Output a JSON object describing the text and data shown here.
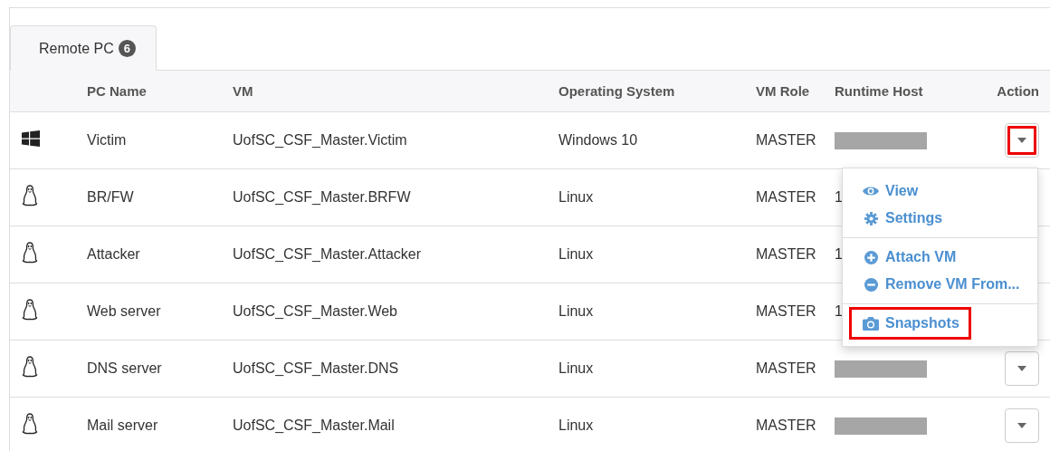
{
  "tabs": [
    {
      "label": "Remote PC",
      "badge": "6",
      "selected": true
    }
  ],
  "table": {
    "columns": [
      "PC Name",
      "VM",
      "Operating System",
      "VM Role",
      "Runtime Host",
      "Action"
    ],
    "rows": [
      {
        "kind": "windows",
        "pc_name": "Victim",
        "vm": "UofSC_CSF_Master.Victim",
        "os": "Windows 10",
        "role": "MASTER",
        "host": {
          "redacted": true
        },
        "action_button": {
          "highlighted": true
        }
      },
      {
        "kind": "linux",
        "pc_name": "BR/FW",
        "vm": "UofSC_CSF_Master.BRFW",
        "os": "Linux",
        "role": "MASTER",
        "host": {
          "text": "1"
        }
      },
      {
        "kind": "linux",
        "pc_name": "Attacker",
        "vm": "UofSC_CSF_Master.Attacker",
        "os": "Linux",
        "role": "MASTER",
        "host": {
          "text": "1"
        }
      },
      {
        "kind": "linux",
        "pc_name": "Web server",
        "vm": "UofSC_CSF_Master.Web",
        "os": "Linux",
        "role": "MASTER",
        "host": {
          "text": "1"
        }
      },
      {
        "kind": "linux",
        "pc_name": "DNS server",
        "vm": "UofSC_CSF_Master.DNS",
        "os": "Linux",
        "role": "MASTER",
        "host": {
          "redacted": true
        },
        "action_button": {
          "highlighted": false
        }
      },
      {
        "kind": "linux",
        "pc_name": "Mail server",
        "vm": "UofSC_CSF_Master.Mail",
        "os": "Linux",
        "role": "MASTER",
        "host": {
          "redacted": true
        },
        "action_button": {
          "highlighted": false
        }
      }
    ]
  },
  "action_menu": {
    "groups": [
      [
        {
          "kind": "view",
          "label": "View",
          "highlighted": false
        },
        {
          "kind": "settings",
          "label": "Settings",
          "highlighted": false
        }
      ],
      [
        {
          "kind": "attach",
          "label": "Attach VM",
          "highlighted": false
        },
        {
          "kind": "remove",
          "label": "Remove VM From...",
          "highlighted": false
        }
      ],
      [
        {
          "kind": "snapshot",
          "label": "Snapshots",
          "highlighted": true
        }
      ]
    ]
  }
}
